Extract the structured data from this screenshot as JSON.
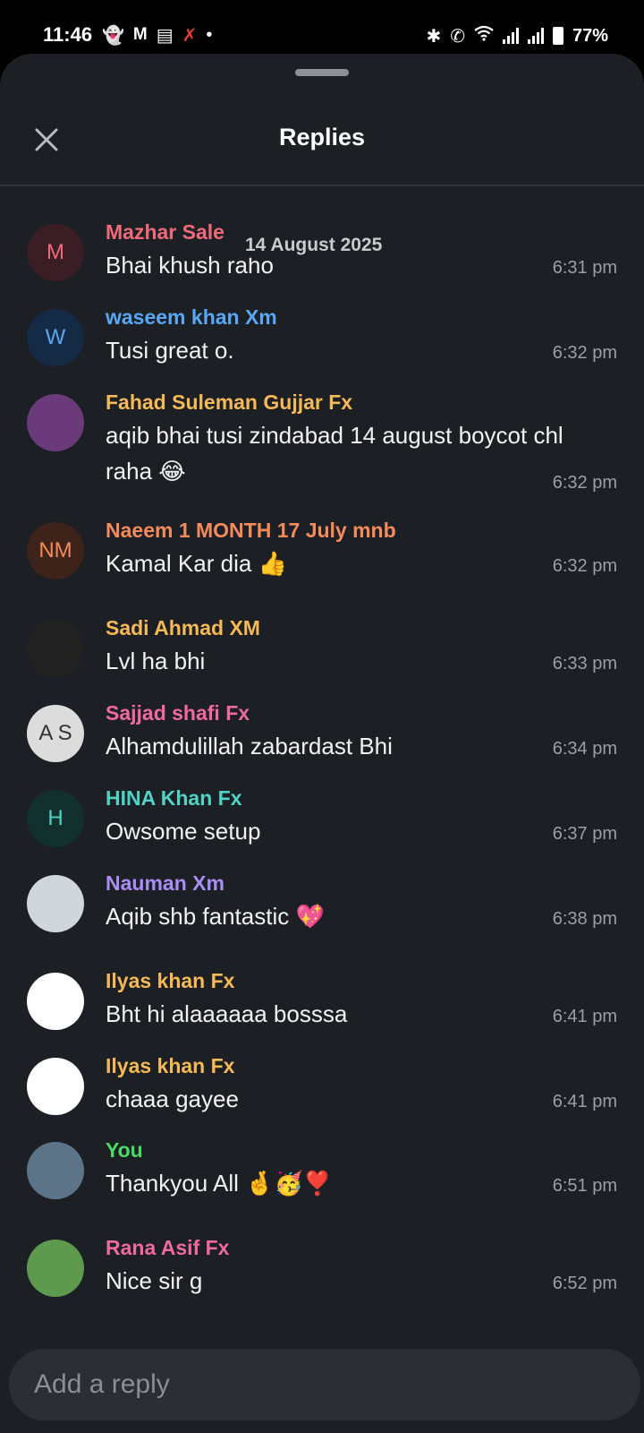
{
  "status_bar": {
    "time": "11:46",
    "battery": "77%",
    "left_icons": [
      "snapchat-icon",
      "gmail-icon",
      "sim-icon",
      "app-icon",
      "dot-icon"
    ],
    "right_icons": [
      "bluetooth-icon",
      "wifi-call-icon",
      "wifi-icon",
      "signal-icon",
      "signal-icon",
      "battery-icon"
    ]
  },
  "header": {
    "title": "Replies",
    "close_icon": "close-icon"
  },
  "date_label": "14 August 2025",
  "colors": {
    "sheet_bg": "#1c1f24",
    "accent_green": "#4cd964",
    "secondary_text": "#9aa0a6"
  },
  "messages": [
    {
      "name": "Mazhar Sale",
      "text": "Bhai khush raho",
      "time": "6:31 pm",
      "avatar_initials": "M",
      "name_color": "#f06a7a",
      "avatar_bg": "#3a1d25",
      "avatar_fg": "#f06a7a"
    },
    {
      "name": "waseem khan Xm",
      "text": "Tusi great o.",
      "time": "6:32 pm",
      "avatar_initials": "W",
      "name_color": "#5aa7f5",
      "avatar_bg": "#152a44",
      "avatar_fg": "#5aa7f5"
    },
    {
      "name": "Fahad Suleman Gujjar Fx",
      "text": "aqib bhai tusi zindabad 14 august boycot chl raha 😂",
      "time": "6:32 pm",
      "avatar_initials": "",
      "name_color": "#f5b955",
      "avatar_bg": "#6a3a7a",
      "avatar_fg": "#fff"
    },
    {
      "name": "Naeem 1 MONTH 17 July mnb",
      "text": "Kamal Kar dia 👍",
      "time": "6:32 pm",
      "avatar_initials": "NM",
      "name_color": "#f58a5a",
      "avatar_bg": "#3d2319",
      "avatar_fg": "#f58a5a"
    },
    {
      "name": "Sadi Ahmad XM",
      "text": "Lvl ha bhi",
      "time": "6:33 pm",
      "avatar_initials": "",
      "name_color": "#f5b955",
      "avatar_bg": "#222",
      "avatar_fg": "#fff"
    },
    {
      "name": "Sajjad shafi Fx",
      "text": "Alhamdulillah zabardast Bhi",
      "time": "6:34 pm",
      "avatar_initials": "A S",
      "name_color": "#f06aa0",
      "avatar_bg": "#dcdcdc",
      "avatar_fg": "#333"
    },
    {
      "name": "HINA Khan Fx",
      "text": "Owsome setup",
      "time": "6:37 pm",
      "avatar_initials": "H",
      "name_color": "#4fd3c4",
      "avatar_bg": "#12302d",
      "avatar_fg": "#4fd3c4"
    },
    {
      "name": "Nauman Xm",
      "text": "Aqib shb fantastic 💖",
      "time": "6:38 pm",
      "avatar_initials": "",
      "name_color": "#a98ef5",
      "avatar_bg": "#cfd6dc",
      "avatar_fg": "#333"
    },
    {
      "name": "Ilyas khan Fx",
      "text": "Bht hi alaaaaaa bosssa",
      "time": "6:41 pm",
      "avatar_initials": "",
      "name_color": "#f5b955",
      "avatar_bg": "#ffffff",
      "avatar_fg": "#333"
    },
    {
      "name": "Ilyas khan Fx",
      "text": "chaaa gayee",
      "time": "6:41 pm",
      "avatar_initials": "",
      "name_color": "#f5b955",
      "avatar_bg": "#ffffff",
      "avatar_fg": "#333"
    },
    {
      "name": "You",
      "text": "Thankyou All 🤞🥳❣️",
      "time": "6:51 pm",
      "avatar_initials": "",
      "name_color": "#4cd964",
      "avatar_bg": "#5d7488",
      "avatar_fg": "#fff"
    },
    {
      "name": "Rana Asif Fx",
      "text": "Nice sir g",
      "time": "6:52 pm",
      "avatar_initials": "",
      "name_color": "#f06aa0",
      "avatar_bg": "#5e9a4d",
      "avatar_fg": "#fff"
    }
  ],
  "reply": {
    "placeholder": "Add a reply",
    "value": ""
  }
}
